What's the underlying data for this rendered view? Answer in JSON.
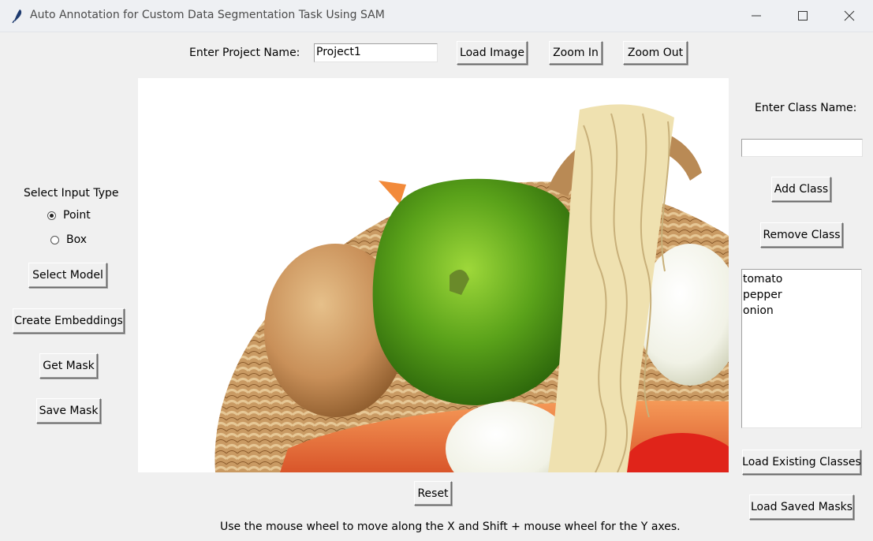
{
  "window": {
    "title": "Auto Annotation for Custom Data Segmentation Task Using SAM",
    "icon": "feather-icon",
    "controls": [
      "minimize-icon",
      "maximize-icon",
      "close-icon"
    ]
  },
  "toolbar": {
    "project_label": "Enter Project Name:",
    "project_value": "Project1",
    "load_image": "Load Image",
    "zoom_in": "Zoom In",
    "zoom_out": "Zoom Out"
  },
  "left_panel": {
    "input_type_label": "Select Input Type",
    "options": [
      {
        "label": "Point",
        "selected": true
      },
      {
        "label": "Box",
        "selected": false
      }
    ],
    "select_model": "Select Model",
    "create_embeddings": "Create Embeddings",
    "get_mask": "Get Mask",
    "save_mask": "Save Mask"
  },
  "right_panel": {
    "class_label": "Enter Class Name:",
    "class_value": "",
    "add_class": "Add Class",
    "remove_class": "Remove Class",
    "classes": [
      "tomato",
      "pepper",
      "onion"
    ],
    "load_existing_classes": "Load Existing Classes",
    "load_saved_masks": "Load Saved Masks"
  },
  "bottom": {
    "reset": "Reset",
    "hint": "Use the mouse wheel to move along the X and Shift + mouse wheel for the Y axes."
  },
  "colors": {
    "background": "#f0f0f0",
    "titlebar": "#eef0f3",
    "canvas": "#ffffff"
  }
}
